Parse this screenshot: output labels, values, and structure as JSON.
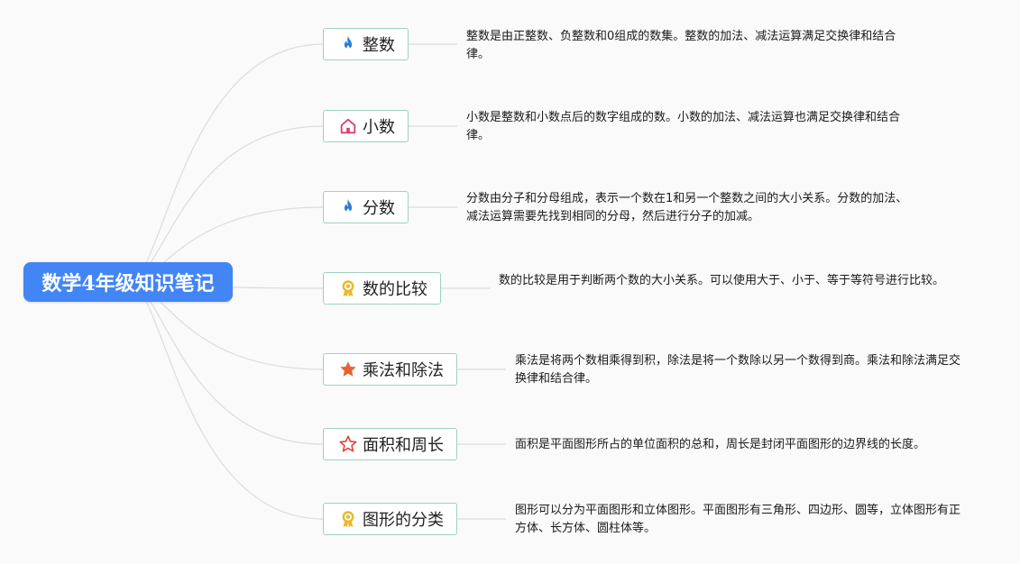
{
  "root": {
    "title": "数学4年级知识笔记"
  },
  "topics": [
    {
      "label": "整数",
      "icon": "fire-icon",
      "icon_color": "#2a7fd4",
      "note": "整数是由正整数、负整数和0组成的数集。整数的加法、减法运算满足交换律和结合律。"
    },
    {
      "label": "小数",
      "icon": "house-icon",
      "icon_color": "#d8426c",
      "note": "小数是整数和小数点后的数字组成的数。小数的加法、减法运算也满足交换律和结合律。"
    },
    {
      "label": "分数",
      "icon": "fire-icon",
      "icon_color": "#2a7fd4",
      "note": "分数由分子和分母组成，表示一个数在1和另一个整数之间的大小关系。分数的加法、减法运算需要先找到相同的分母，然后进行分子的加减。"
    },
    {
      "label": "数的比较",
      "icon": "award-ribbon-icon",
      "icon_color": "#e8b92a",
      "note": "数的比较是用于判断两个数的大小关系。可以使用大于、小于、等于等符号进行比较。"
    },
    {
      "label": "乘法和除法",
      "icon": "star-filled-icon",
      "icon_color": "#e8632f",
      "note": "乘法是将两个数相乘得到积，除法是将一个数除以另一个数得到商。乘法和除法满足交换律和结合律。"
    },
    {
      "label": "面积和周长",
      "icon": "star-outline-icon",
      "icon_color": "#e0453a",
      "note": "面积是平面图形所占的单位面积的总和，周长是封闭平面图形的边界线的长度。"
    },
    {
      "label": "图形的分类",
      "icon": "award-ribbon-icon",
      "icon_color": "#e8b92a",
      "note": "图形可以分为平面图形和立体图形。平面图形有三角形、四边形、圆等，立体图形有正方体、长方体、圆柱体等。"
    }
  ],
  "colors": {
    "root_bg": "#4285f4",
    "topic_border": "#9fd0c2",
    "connector": "#dcdcdc",
    "background": "#fafafa"
  }
}
